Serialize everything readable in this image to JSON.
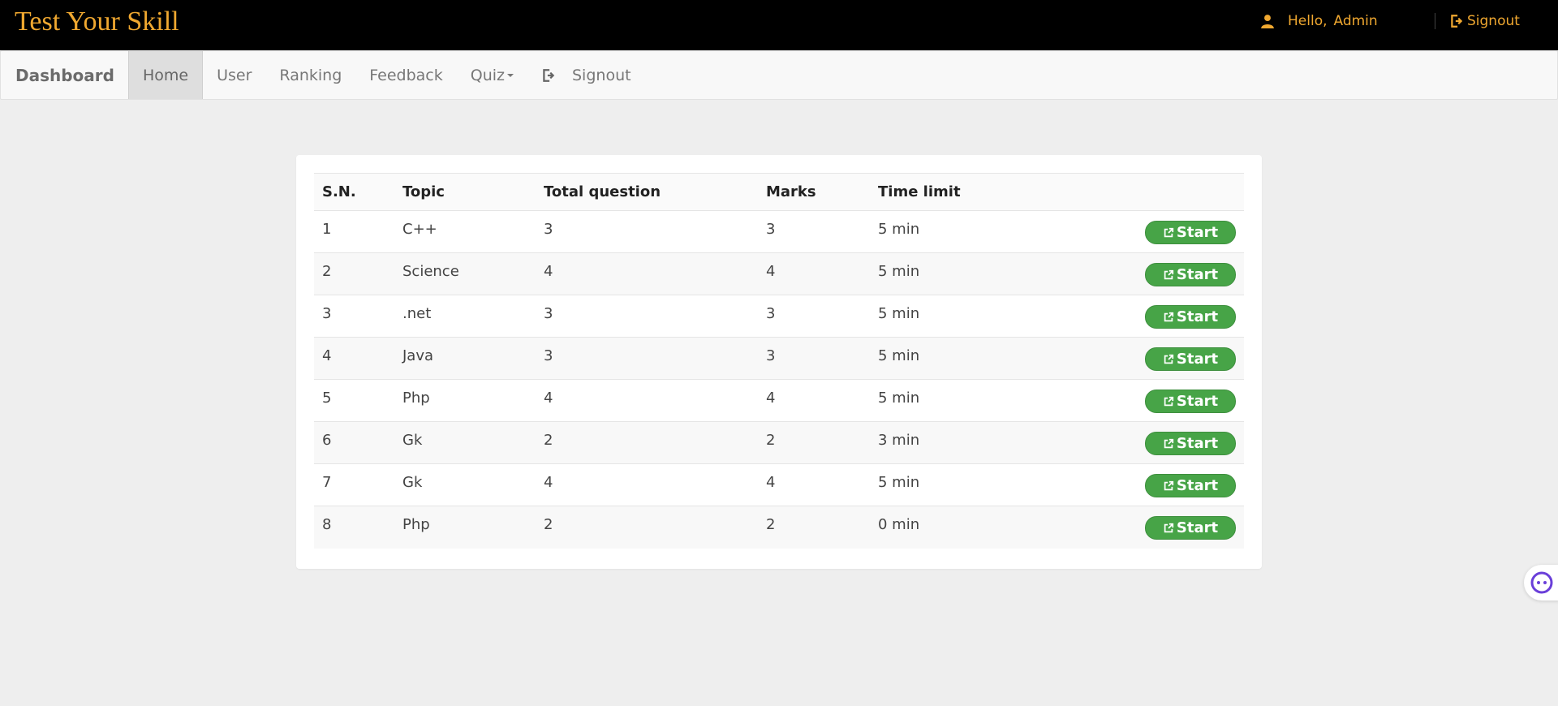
{
  "header": {
    "brand": "Test Your Skill",
    "hello_label": "Hello,",
    "username": "Admin",
    "signout_label": "Signout"
  },
  "navbar": {
    "brand": "Dashboard",
    "items": [
      {
        "label": "Home",
        "active": true
      },
      {
        "label": "User"
      },
      {
        "label": "Ranking"
      },
      {
        "label": "Feedback"
      },
      {
        "label": "Quiz"
      },
      {
        "label": "Signout"
      }
    ]
  },
  "table": {
    "headers": [
      "S.N.",
      "Topic",
      "Total question",
      "Marks",
      "Time limit"
    ],
    "start_label": "Start",
    "rows": [
      {
        "sn": "1",
        "topic": "C++",
        "total": "3",
        "marks": "3",
        "time": "5 min"
      },
      {
        "sn": "2",
        "topic": "Science",
        "total": "4",
        "marks": "4",
        "time": "5 min"
      },
      {
        "sn": "3",
        "topic": ".net",
        "total": "3",
        "marks": "3",
        "time": "5 min"
      },
      {
        "sn": "4",
        "topic": "Java",
        "total": "3",
        "marks": "3",
        "time": "5 min"
      },
      {
        "sn": "5",
        "topic": "Php",
        "total": "4",
        "marks": "4",
        "time": "5 min"
      },
      {
        "sn": "6",
        "topic": "Gk",
        "total": "2",
        "marks": "2",
        "time": "3 min"
      },
      {
        "sn": "7",
        "topic": "Gk",
        "total": "4",
        "marks": "4",
        "time": "5 min"
      },
      {
        "sn": "8",
        "topic": "Php",
        "total": "2",
        "marks": "2",
        "time": "0 min"
      }
    ]
  },
  "colors": {
    "brand": "#f0a830",
    "start_button": "#47a447",
    "topbar": "#000000"
  },
  "icons": {
    "user": "person-icon",
    "signout": "signout-icon",
    "start": "external-link-icon",
    "helper": "assistant-bubble-icon"
  }
}
